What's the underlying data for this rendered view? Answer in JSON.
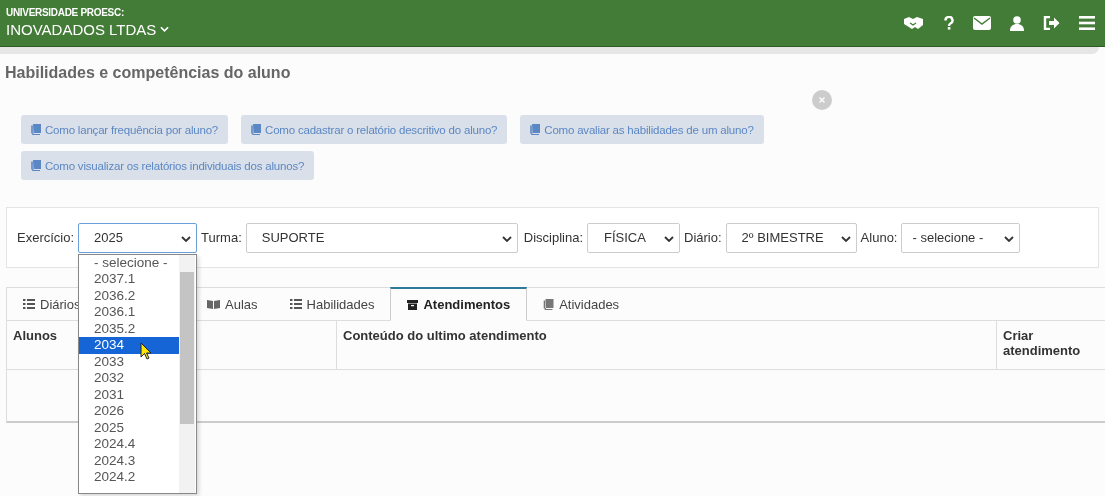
{
  "header": {
    "institution": "UNIVERSIDADE PROESC:",
    "company": "INOVADADOS LTDAS"
  },
  "page_title": "Habilidades e competências do aluno",
  "help_links": [
    "Como lançar frequência por aluno?",
    "Como cadastrar o relatório descritivo do aluno?",
    "Como avaliar as habilidades de um aluno?",
    "Como visualizar os relatórios individuais dos alunos?"
  ],
  "filters": [
    {
      "label": "Exercício:",
      "value": "2025",
      "open": true
    },
    {
      "label": "Turma:",
      "value": "SUPORTE",
      "open": false
    },
    {
      "label": "Disciplina:",
      "value": "FÍSICA",
      "open": false
    },
    {
      "label": "Diário:",
      "value": "2º BIMESTRE",
      "open": false
    },
    {
      "label": "Aluno:",
      "value": "- selecione -",
      "open": false
    }
  ],
  "dropdown_options": [
    {
      "label": "- selecione -",
      "selected": false
    },
    {
      "label": "2037.1",
      "selected": false
    },
    {
      "label": "2036.2",
      "selected": false
    },
    {
      "label": "2036.1",
      "selected": false
    },
    {
      "label": "2035.2",
      "selected": false
    },
    {
      "label": "2034",
      "selected": true
    },
    {
      "label": "2033",
      "selected": false
    },
    {
      "label": "2032",
      "selected": false
    },
    {
      "label": "2031",
      "selected": false
    },
    {
      "label": "2026",
      "selected": false
    },
    {
      "label": "2025",
      "selected": false
    },
    {
      "label": "2024.4",
      "selected": false
    },
    {
      "label": "2024.3",
      "selected": false
    },
    {
      "label": "2024.2",
      "selected": false
    }
  ],
  "tabs": [
    {
      "label": "Diários",
      "selected": false
    },
    {
      "label": "Aulas",
      "selected": false
    },
    {
      "label": "Habilidades",
      "selected": false
    },
    {
      "label": "Atendimentos",
      "selected": true
    },
    {
      "label": "Atividades",
      "selected": false
    }
  ],
  "table": {
    "columns": [
      "Alunos",
      "Conteúdo do ultimo atendimento",
      "Criar atendimento"
    ]
  }
}
